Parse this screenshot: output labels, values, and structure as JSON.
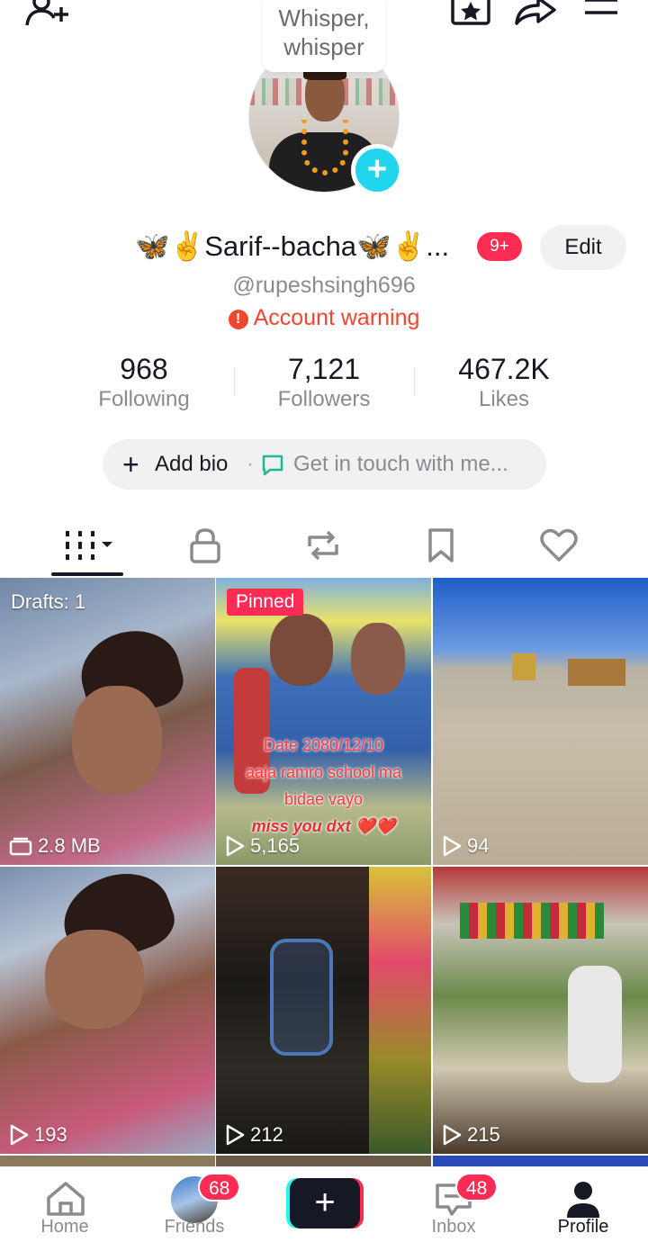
{
  "top_bar": {
    "whisper_line1": "Whisper,",
    "whisper_line2": "whisper",
    "icons": [
      "add-friend-icon",
      "favorites-icon",
      "share-icon",
      "menu-icon"
    ]
  },
  "profile": {
    "avatar_plus": "+",
    "display_name": "🦋✌️Sarif--bacha🦋✌️...",
    "notification_badge": "9+",
    "edit_label": "Edit",
    "username": "@rupeshsingh696",
    "warning_text": "Account warning"
  },
  "stats": [
    {
      "value": "968",
      "label": "Following"
    },
    {
      "value": "7,121",
      "label": "Followers"
    },
    {
      "value": "467.2K",
      "label": "Likes"
    }
  ],
  "bio": {
    "add_bio": "Add bio",
    "separator": "·",
    "get_in_touch": "Get in touch with me..."
  },
  "tabs": [
    "videos-grid-icon",
    "private-lock-icon",
    "repost-icon",
    "favorites-bookmark-icon",
    "liked-heart-icon"
  ],
  "videos": [
    {
      "label": "Drafts: 1",
      "meta": "2.8 MB",
      "meta_icon": "drafts-icon"
    },
    {
      "pinned": "Pinned",
      "meta": "5,165",
      "caption_line1": "Date 2080/12/10",
      "caption_line2": "aaja ramro school ma",
      "caption_line3": "bidae vayo",
      "caption_line4": "miss you dxt ❤️❤️"
    },
    {
      "meta": "94"
    },
    {
      "meta": "193"
    },
    {
      "meta": "212"
    },
    {
      "meta": "215"
    }
  ],
  "bottom_nav": {
    "home": "Home",
    "friends": "Friends",
    "friends_badge": "68",
    "create": "+",
    "inbox": "Inbox",
    "inbox_badge": "48",
    "profile": "Profile"
  },
  "colors": {
    "accent_red": "#fe2c55",
    "accent_cyan": "#20d5ec",
    "warning": "#f2462f"
  }
}
